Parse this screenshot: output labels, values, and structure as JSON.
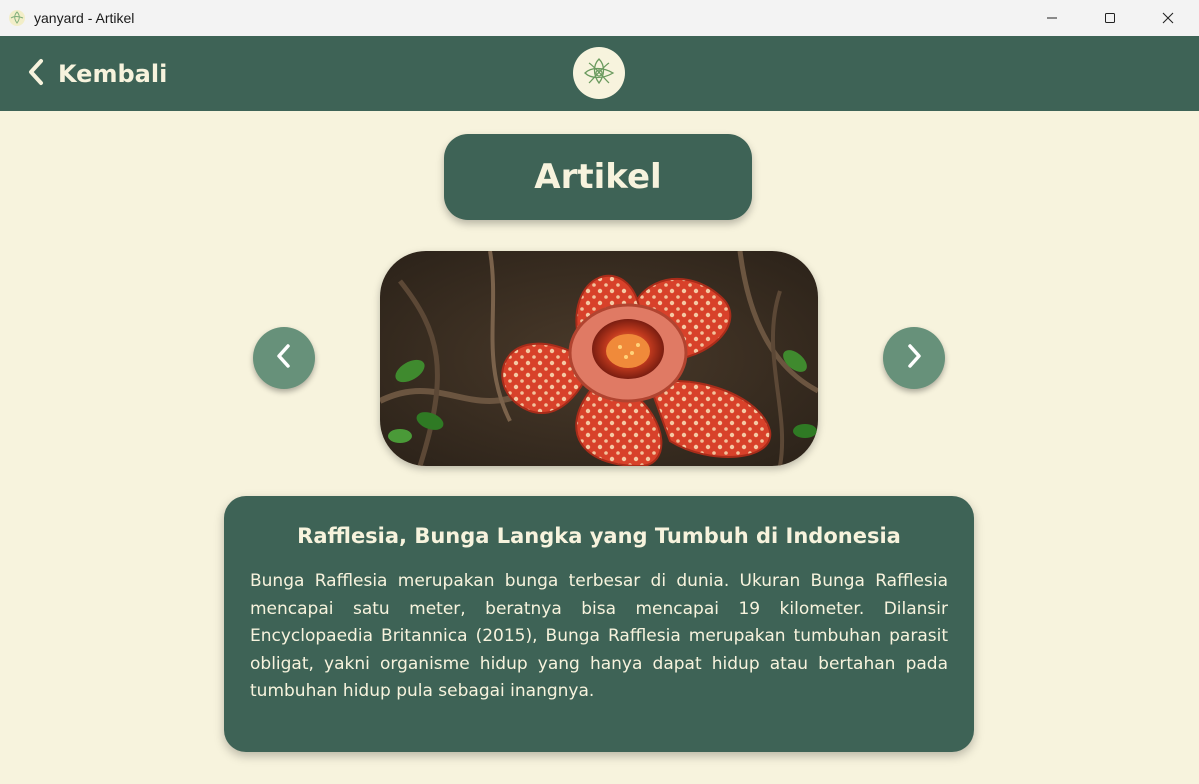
{
  "window": {
    "title": "yanyard - Artikel",
    "minimize_icon": "minimize-icon",
    "maximize_icon": "maximize-icon",
    "close_icon": "close-icon"
  },
  "header": {
    "back_label": "Kembali",
    "back_icon": "chevron-left-icon",
    "logo_icon": "leaf-logo-icon"
  },
  "page": {
    "title": "Artikel"
  },
  "carousel": {
    "prev_icon": "chevron-left-icon",
    "next_icon": "chevron-right-icon",
    "image_subject": "rafflesia-flower-photo"
  },
  "article": {
    "title": "Rafflesia, Bunga Langka yang Tumbuh di Indonesia",
    "body": "Bunga Rafflesia merupakan bunga terbesar di dunia. Ukuran Bunga Rafflesia mencapai satu meter, beratnya bisa mencapai 19 kilometer. Dilansir Encyclopaedia Britannica (2015), Bunga Rafflesia merupakan tumbuhan parasit obligat, yakni organisme hidup yang hanya dapat hidup atau bertahan pada tumbuhan hidup pula sebagai inangnya."
  },
  "colors": {
    "primary": "#3e6356",
    "background": "#f7f3dd",
    "nav_button": "#67917a",
    "text_light": "#f7f3dd"
  }
}
